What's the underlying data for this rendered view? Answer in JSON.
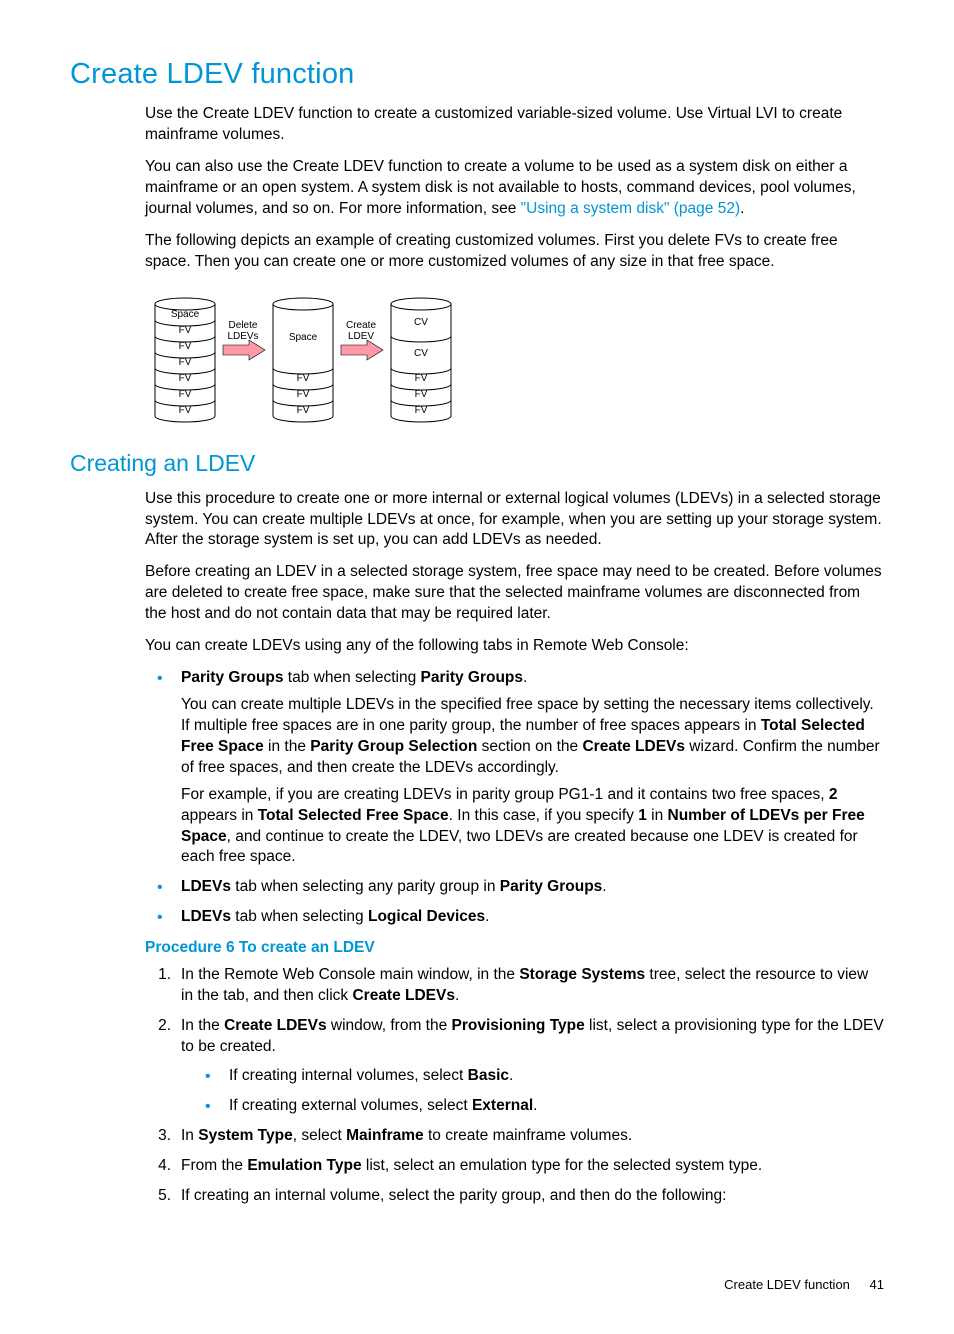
{
  "heading1": "Create LDEV function",
  "p1": "Use the Create LDEV function to create a customized variable-sized volume. Use Virtual LVI to create mainframe volumes.",
  "p2a": "You can also use the Create LDEV function to create a volume to be used as a system disk on either a mainframe or an open system. A system disk is not available to hosts, command devices, pool volumes, journal volumes, and so on. For more information, see ",
  "p2link": "\"Using a system disk\" (page 52)",
  "p2b": ".",
  "p3": "The following depicts an example of creating customized volumes. First you delete FVs to create free space. Then you can create one or more customized volumes of any size in that free space.",
  "diagram": {
    "cyl1": [
      "Space",
      "FV",
      "FV",
      "FV",
      "FV",
      "FV",
      "FV"
    ],
    "arrow1": [
      "Delete",
      "LDEVs"
    ],
    "cyl2": [
      "Space",
      "FV",
      "FV",
      "FV"
    ],
    "arrow2": [
      "Create",
      "LDEV"
    ],
    "cyl3": [
      "CV",
      "CV",
      "FV",
      "FV",
      "FV"
    ]
  },
  "heading2": "Creating an LDEV",
  "p4": "Use this procedure to create one or more internal or external logical volumes (LDEVs) in a selected storage system. You can create multiple LDEVs at once, for example, when you are setting up your storage system. After the storage system is set up, you can add LDEVs as needed.",
  "p5": "Before creating an LDEV in a selected storage system, free space may need to be created. Before volumes are deleted to create free space, make sure that the selected mainframe volumes are disconnected from the host and do not contain data that may be required later.",
  "p6": "You can create LDEVs using any of the following tabs in Remote Web Console:",
  "bullets1": {
    "b1": {
      "pre": "",
      "bold1": "Parity Groups",
      "mid": " tab when selecting ",
      "bold2": "Parity Groups",
      "post": "."
    },
    "b1p1": {
      "a": "You can create multiple LDEVs in the specified free space by setting the necessary items collectively. If multiple free spaces are in one parity group, the number of free spaces appears in ",
      "b": "Total Selected Free Space",
      "c": " in the ",
      "d": "Parity Group Selection",
      "e": " section on the ",
      "f": "Create LDEVs",
      "g": " wizard. Confirm the number of free spaces, and then create the LDEVs accordingly."
    },
    "b1p2": {
      "a": "For example, if you are creating LDEVs in parity group PG1-1 and it contains two free spaces, ",
      "b": "2",
      "c": " appears in ",
      "d": "Total Selected Free Space",
      "e": ". In this case, if you specify ",
      "f": "1",
      "g": " in ",
      "h": "Number of LDEVs per Free Space",
      "i": ", and continue to create the LDEV, two LDEVs are created because one LDEV is created for each free space."
    },
    "b2": {
      "bold1": "LDEVs",
      "mid": " tab when selecting any parity group in ",
      "bold2": "Parity Groups",
      "post": "."
    },
    "b3": {
      "bold1": "LDEVs",
      "mid": " tab when selecting ",
      "bold2": "Logical Devices",
      "post": "."
    }
  },
  "procTitle": "Procedure 6 To create an LDEV",
  "steps": {
    "s1": {
      "a": "In the Remote Web Console main window, in the ",
      "b": "Storage Systems",
      "c": " tree, select the resource to view in the tab, and then click ",
      "d": "Create LDEVs",
      "e": "."
    },
    "s2": {
      "a": "In the ",
      "b": "Create LDEVs",
      "c": " window, from the ",
      "d": "Provisioning Type",
      "e": " list, select a provisioning type for the LDEV to be created."
    },
    "s2b1": {
      "a": "If creating internal volumes, select ",
      "b": "Basic",
      "c": "."
    },
    "s2b2": {
      "a": "If creating external volumes, select ",
      "b": "External",
      "c": "."
    },
    "s3": {
      "a": "In ",
      "b": "System Type",
      "c": ", select ",
      "d": "Mainframe",
      "e": " to create mainframe volumes."
    },
    "s4": {
      "a": "From the ",
      "b": "Emulation Type",
      "c": " list, select an emulation type for the selected system type."
    },
    "s5": {
      "a": "If creating an internal volume, select the parity group, and then do the following:"
    }
  },
  "footer": {
    "text": "Create LDEV function",
    "page": "41"
  }
}
